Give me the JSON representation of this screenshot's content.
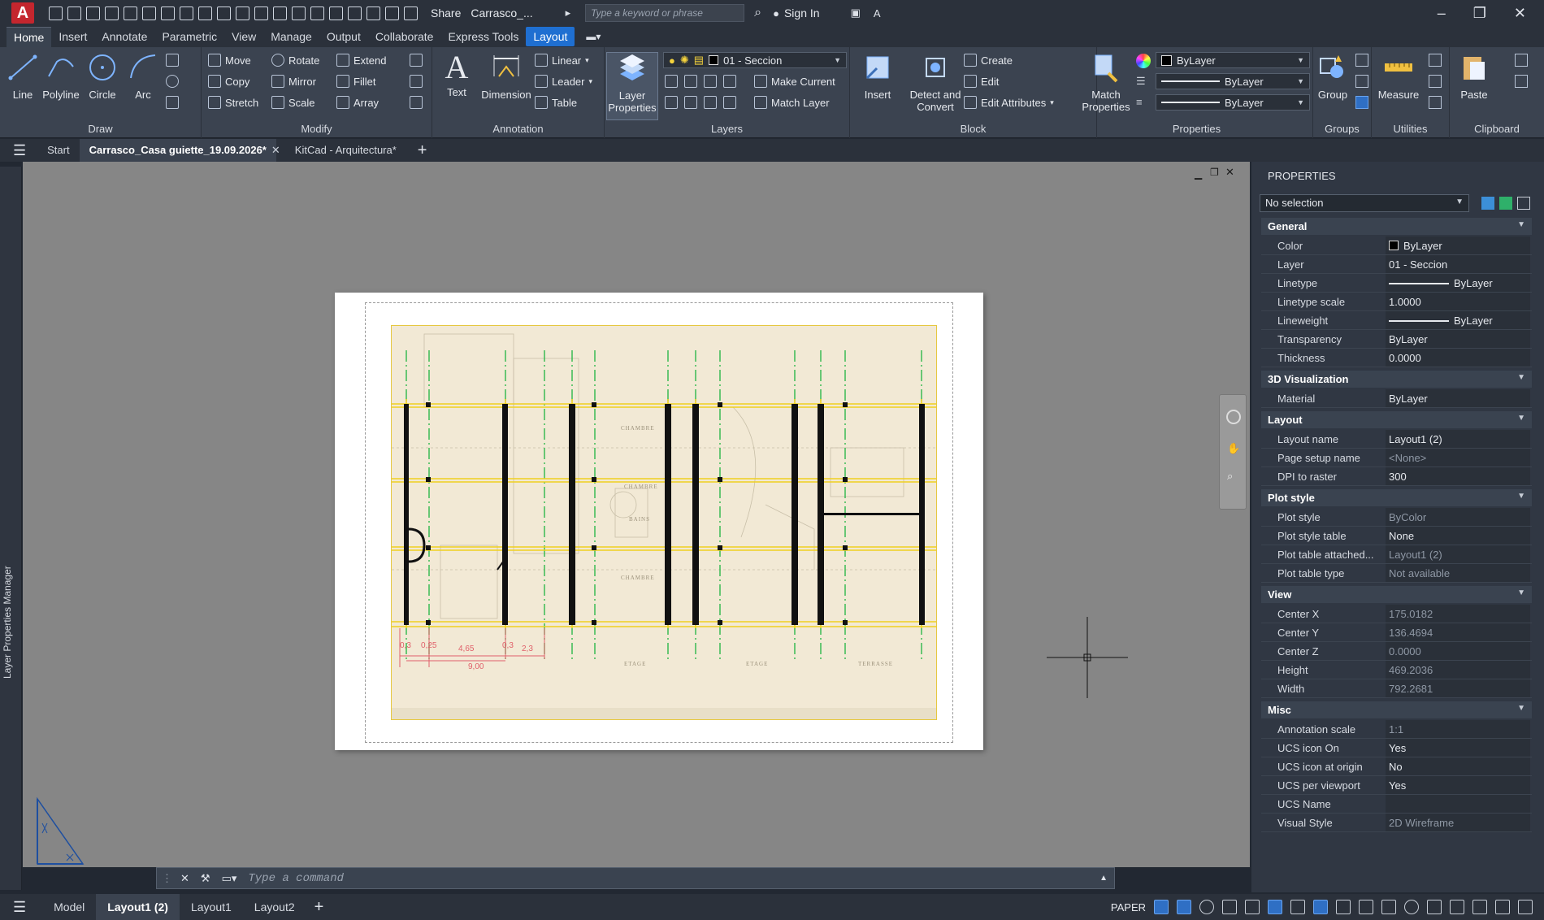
{
  "app": {
    "title": "Carrasco_...",
    "search_placeholder": "Type a keyword or phrase",
    "share_label": "Share",
    "signin_label": "Sign In"
  },
  "menu_tabs": [
    "Home",
    "Insert",
    "Annotate",
    "Parametric",
    "View",
    "Manage",
    "Output",
    "Collaborate",
    "Express Tools",
    "Layout"
  ],
  "ribbon": {
    "draw": {
      "title": "Draw",
      "line": "Line",
      "polyline": "Polyline",
      "circle": "Circle",
      "arc": "Arc"
    },
    "modify": {
      "title": "Modify",
      "move": "Move",
      "rotate": "Rotate",
      "extend": "Extend",
      "copy": "Copy",
      "mirror": "Mirror",
      "fillet": "Fillet",
      "stretch": "Stretch",
      "scale": "Scale",
      "array": "Array"
    },
    "annotation": {
      "title": "Annotation",
      "text": "Text",
      "dimension": "Dimension",
      "linear": "Linear",
      "leader": "Leader",
      "table": "Table"
    },
    "layers": {
      "title": "Layers",
      "layer_properties": "Layer Properties",
      "current_layer": "01 - Seccion",
      "make_current": "Make Current",
      "match_layer": "Match Layer"
    },
    "block": {
      "title": "Block",
      "insert": "Insert",
      "detect": "Detect and Convert",
      "create": "Create",
      "edit": "Edit",
      "edit_attributes": "Edit Attributes"
    },
    "properties": {
      "title": "Properties",
      "match": "Match Properties",
      "color": "ByLayer",
      "lineweight": "ByLayer",
      "linetype": "ByLayer"
    },
    "groups": {
      "title": "Groups",
      "group": "Group"
    },
    "utilities": {
      "title": "Utilities",
      "measure": "Measure"
    },
    "clipboard": {
      "title": "Clipboard",
      "paste": "Paste"
    }
  },
  "doc_tabs": {
    "start": "Start",
    "active": "Carrasco_Casa guiette_19.09.2026*",
    "other": "KitCad - Arquitectura*"
  },
  "palette_left": "Layer Properties Manager",
  "drawing": {
    "room_labels": [
      "CHAMBRE",
      "CHAMBRE",
      "BAINS",
      "CHAMBRE",
      "ETAGE",
      "ETAGE",
      "TERRASSE"
    ],
    "dims": [
      "4,65",
      "2,3",
      "9,00",
      "0,3",
      "0,25",
      "0,3"
    ]
  },
  "properties": {
    "title": "PROPERTIES",
    "selection": "No selection",
    "sections": {
      "general": "General",
      "viz": "3D Visualization",
      "layout": "Layout",
      "plot": "Plot style",
      "view": "View",
      "misc": "Misc"
    },
    "general": [
      {
        "k": "Color",
        "v": "ByLayer"
      },
      {
        "k": "Layer",
        "v": "01 - Seccion"
      },
      {
        "k": "Linetype",
        "v": "ByLayer"
      },
      {
        "k": "Linetype scale",
        "v": "1.0000"
      },
      {
        "k": "Lineweight",
        "v": "ByLayer"
      },
      {
        "k": "Transparency",
        "v": "ByLayer"
      },
      {
        "k": "Thickness",
        "v": "0.0000"
      }
    ],
    "viz": [
      {
        "k": "Material",
        "v": "ByLayer"
      }
    ],
    "layout": [
      {
        "k": "Layout name",
        "v": "Layout1 (2)"
      },
      {
        "k": "Page setup name",
        "v": "<None>"
      },
      {
        "k": "DPI to raster",
        "v": "300"
      }
    ],
    "plot": [
      {
        "k": "Plot style",
        "v": "ByColor"
      },
      {
        "k": "Plot style table",
        "v": "None"
      },
      {
        "k": "Plot table attached...",
        "v": "Layout1 (2)"
      },
      {
        "k": "Plot table type",
        "v": "Not available"
      }
    ],
    "view": [
      {
        "k": "Center X",
        "v": "175.0182"
      },
      {
        "k": "Center Y",
        "v": "136.4694"
      },
      {
        "k": "Center Z",
        "v": "0.0000"
      },
      {
        "k": "Height",
        "v": "469.2036"
      },
      {
        "k": "Width",
        "v": "792.2681"
      }
    ],
    "misc": [
      {
        "k": "Annotation scale",
        "v": "1:1"
      },
      {
        "k": "UCS icon On",
        "v": "Yes"
      },
      {
        "k": "UCS icon at origin",
        "v": "No"
      },
      {
        "k": "UCS per viewport",
        "v": "Yes"
      },
      {
        "k": "UCS Name",
        "v": ""
      },
      {
        "k": "Visual Style",
        "v": "2D Wireframe"
      }
    ]
  },
  "command": {
    "placeholder": "Type a command"
  },
  "status": {
    "model": "Model",
    "active": "Layout1 (2)",
    "layout1": "Layout1",
    "layout2": "Layout2",
    "paper": "PAPER"
  }
}
